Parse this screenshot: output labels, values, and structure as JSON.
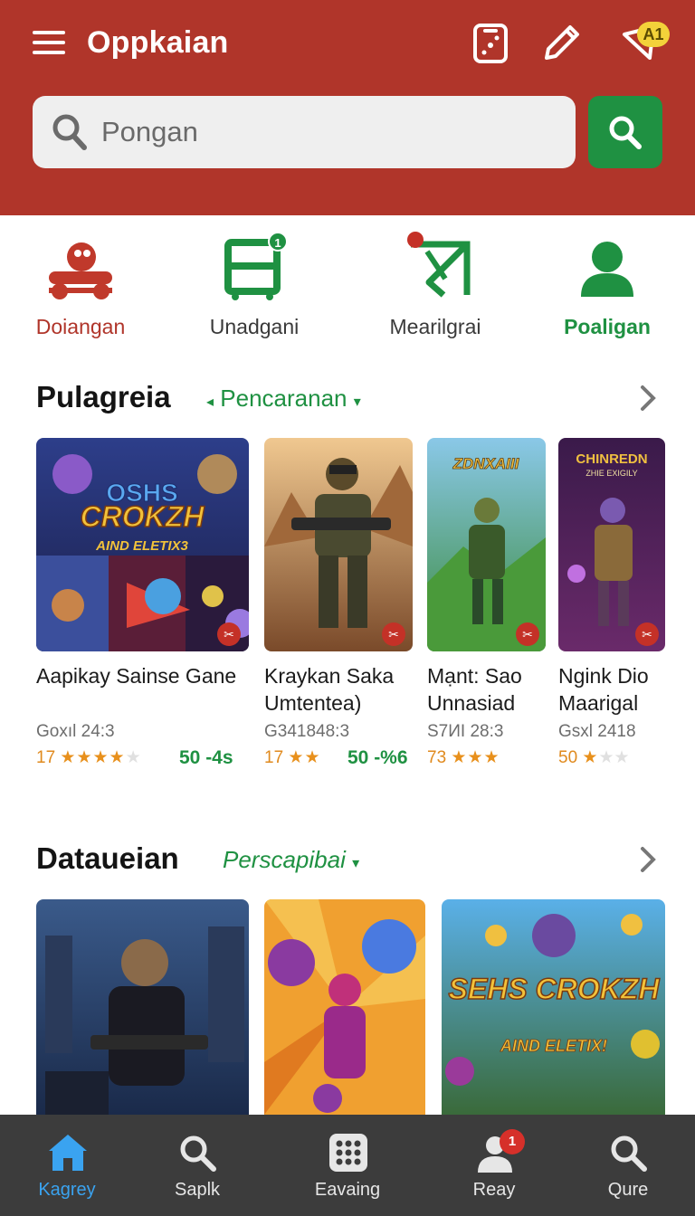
{
  "header": {
    "title": "Oppkaian",
    "badge": "A1",
    "icons": [
      "dice-icon",
      "pencil-icon",
      "tag-icon"
    ]
  },
  "search": {
    "placeholder": "Pongan"
  },
  "categories": [
    {
      "label": "Doiangan",
      "icon": "joystick-icon",
      "color": "#c0392b"
    },
    {
      "label": "Unadgani",
      "icon": "cart-icon",
      "badge": "1",
      "color": "#1f9142"
    },
    {
      "label": "Mearilgrai",
      "icon": "paper-plane-icon",
      "color": "#1f9142"
    },
    {
      "label": "Poaligan",
      "icon": "user-icon",
      "color": "#1f9142"
    }
  ],
  "section1": {
    "title": "Pulagreia",
    "filter": "Pencaranan",
    "cards": [
      {
        "name": "Aapikay Sainse Gane",
        "meta": "Goxıl 24:3",
        "rating_num": "17",
        "stars": "★★★★",
        "stars_off": "★",
        "price": "50 -4s",
        "art_title": "OSHS CROKZH",
        "art_sub": "AIND ELETIX3"
      },
      {
        "name": "Kraykan Saka Umtentea)",
        "meta": "G341848:3",
        "rating_num": "17",
        "stars": "★★",
        "stars_off": "",
        "price": "50 -%6"
      },
      {
        "name": "Mạnt: Sao Unnasiad",
        "meta": "S7ИI 28:3",
        "rating_num": "73",
        "stars": "★★★",
        "stars_off": "",
        "price": "",
        "art_title": "ZDNXAIII"
      },
      {
        "name": "Ngink Dio Maarigal",
        "meta": "Gsxl 2418",
        "rating_num": "50",
        "stars": "★",
        "stars_off": "★★",
        "price": "",
        "art_title": "CHINREDN",
        "art_sub": "ZHIE EXIGILY"
      }
    ]
  },
  "section2": {
    "title": "Datauеian",
    "filter": "Perscapibai",
    "cards": [
      {
        "art": "soldier-dark"
      },
      {
        "art": "hero-balls"
      },
      {
        "art_title": "SEHS CROKZH",
        "art_sub": "AIND ELETIX!"
      }
    ]
  },
  "bottom_nav": [
    {
      "label": "Kagrey",
      "icon": "home-icon",
      "active": true
    },
    {
      "label": "Saplk",
      "icon": "search-icon"
    },
    {
      "label": "Eavaing",
      "icon": "grid-icon"
    },
    {
      "label": "Reay",
      "icon": "user-icon",
      "badge": "1"
    },
    {
      "label": "Qure",
      "icon": "search-icon"
    }
  ],
  "colors": {
    "header_bg": "#b0352a",
    "accent_green": "#1f9142",
    "accent_red": "#c43127",
    "nav_bg": "#3c3c3c",
    "nav_active": "#3aa3f0"
  }
}
